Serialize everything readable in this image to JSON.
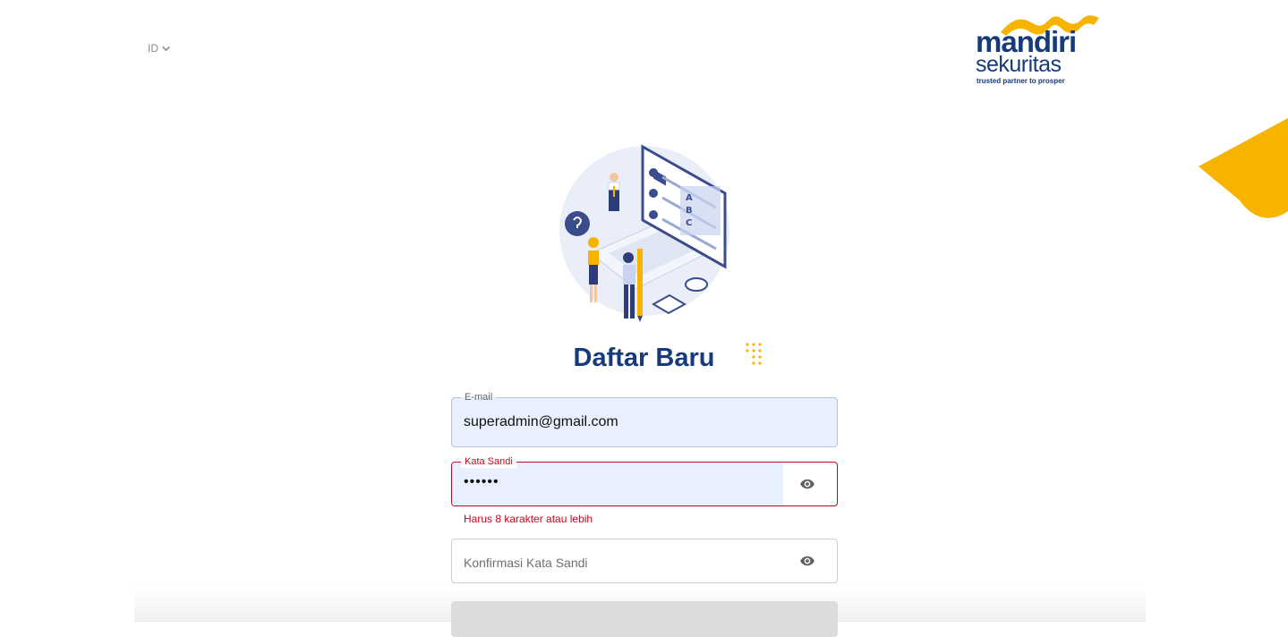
{
  "header": {
    "language": "ID",
    "logo": {
      "brand_line1": "mandiri",
      "brand_line2": "sekuritas",
      "tagline": "trusted partner to prosper"
    }
  },
  "main": {
    "title": "Daftar Baru",
    "illustration_letters": [
      "A",
      "B",
      "C"
    ],
    "form": {
      "email": {
        "label": "E-mail",
        "value": "superadmin@gmail.com"
      },
      "password": {
        "label": "Kata Sandi",
        "value": "••••••",
        "error": "Harus 8 karakter atau lebih"
      },
      "confirm": {
        "placeholder": "Konfirmasi Kata Sandi"
      }
    }
  },
  "colors": {
    "brand_blue": "#173a7a",
    "brand_yellow": "#f6b400",
    "error_red": "#d0021b",
    "autofill_bg": "#e8f0fe"
  }
}
